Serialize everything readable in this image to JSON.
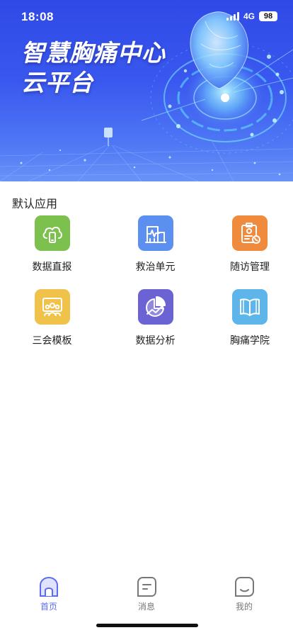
{
  "status_bar": {
    "time": "18:08",
    "network": "4G",
    "battery": "98"
  },
  "banner": {
    "title_line1": "智慧胸痛中心",
    "title_line2": "云平台"
  },
  "apps_section": {
    "title": "默认应用",
    "items": [
      {
        "label": "数据直报",
        "icon": "cloud-phone-icon",
        "color": "#7cc04e"
      },
      {
        "label": "救治单元",
        "icon": "hospital-heartbeat-icon",
        "color": "#5b8ff0"
      },
      {
        "label": "随访管理",
        "icon": "clipboard-phone-icon",
        "color": "#f08a3c"
      },
      {
        "label": "三会模板",
        "icon": "meeting-screen-icon",
        "color": "#f1c24a"
      },
      {
        "label": "数据分析",
        "icon": "pie-chart-trend-icon",
        "color": "#6b63d4"
      },
      {
        "label": "胸痛学院",
        "icon": "open-book-icon",
        "color": "#5eb5ea"
      }
    ]
  },
  "tab_bar": {
    "tabs": [
      {
        "label": "首页",
        "icon": "home-icon",
        "active": true
      },
      {
        "label": "消息",
        "icon": "message-icon",
        "active": false
      },
      {
        "label": "我的",
        "icon": "profile-icon",
        "active": false
      }
    ],
    "active_color": "#5b6cf0"
  }
}
